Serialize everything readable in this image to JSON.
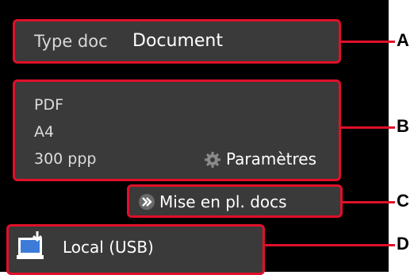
{
  "doc_type": {
    "label": "Type doc",
    "value": "Document"
  },
  "scan_settings": {
    "format": "PDF",
    "size": "A4",
    "resolution": "300 ppp",
    "settings_label": "Paramètres",
    "settings_icon": "gear-icon"
  },
  "place_documents": {
    "label": "Mise en pl. docs",
    "icon": "double-chevron-icon"
  },
  "destination": {
    "label": "Local (USB)",
    "icon": "computer-download-icon"
  },
  "callouts": [
    "A",
    "B",
    "C",
    "D"
  ],
  "colors": {
    "highlight": "#e0102a",
    "panel": "#3a3a3a",
    "screen": "#000000",
    "text": "#ffffff"
  }
}
